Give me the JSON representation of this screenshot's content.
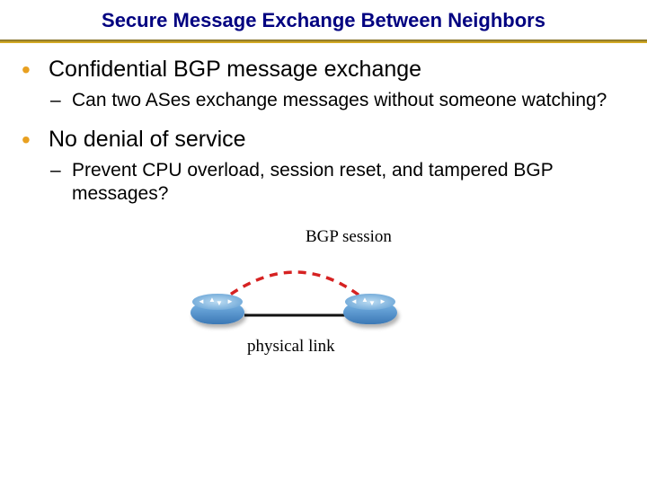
{
  "title": "Secure Message Exchange Between Neighbors",
  "bullets": [
    {
      "text": "Confidential BGP message exchange",
      "sub": [
        "Can two ASes exchange messages without someone watching?"
      ]
    },
    {
      "text": "No denial of service",
      "sub": [
        "Prevent CPU overload, session reset, and tampered BGP messages?"
      ]
    }
  ],
  "diagram": {
    "session_label": "BGP session",
    "physical_label": "physical link"
  }
}
